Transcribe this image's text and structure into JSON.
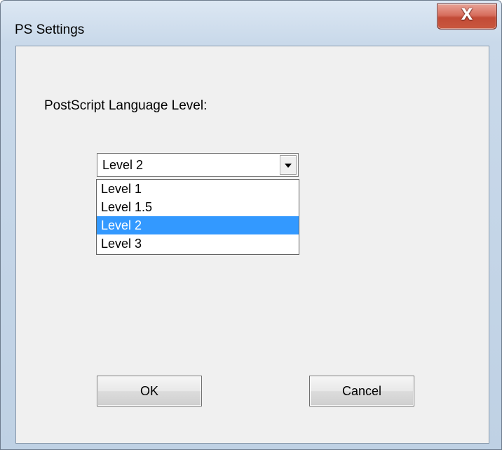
{
  "window": {
    "title": "PS Settings",
    "close_glyph": "X",
    "close_icon": "close-icon"
  },
  "dialog": {
    "prompt_label": "PostScript Language Level:",
    "combo": {
      "selected_value": "Level 2",
      "arrow_icon": "chevron-down-icon",
      "options": [
        "Level 1",
        "Level 1.5",
        "Level 2",
        "Level 3"
      ],
      "highlighted_index": 2
    },
    "ok_label": "OK",
    "cancel_label": "Cancel"
  },
  "colors": {
    "selection": "#3399ff",
    "close_button": "#c9583f",
    "client_bg": "#f0f0f0"
  }
}
